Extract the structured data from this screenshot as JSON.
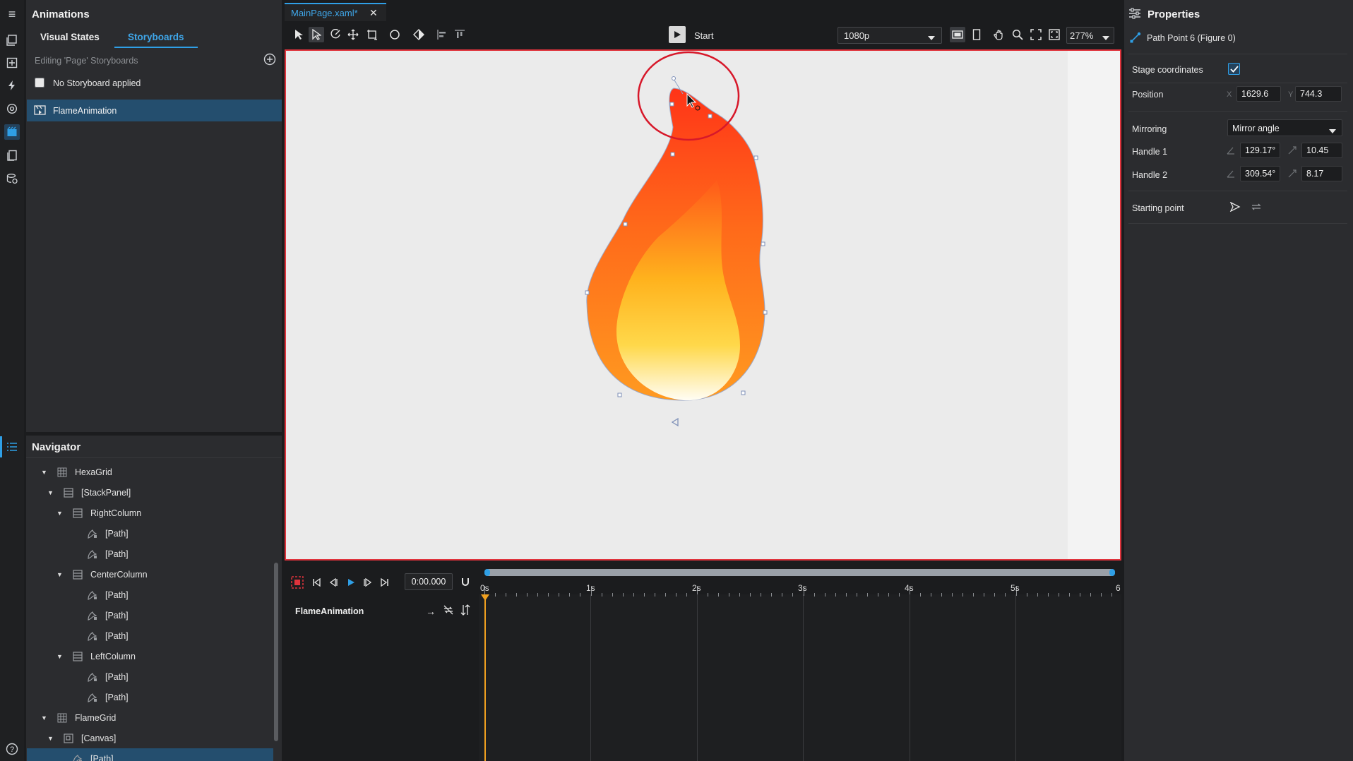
{
  "left_panel": {
    "title": "Animations",
    "tabs": [
      "Visual States",
      "Storyboards"
    ],
    "active_tab": "Storyboards",
    "editing_label": "Editing 'Page' Storyboards",
    "no_storyboard_label": "No Storyboard applied",
    "storyboards": [
      "FlameAnimation"
    ]
  },
  "navigator": {
    "title": "Navigator",
    "items": [
      {
        "label": "HexaGrid",
        "depth": 0,
        "kind": "grid",
        "expanded": true
      },
      {
        "label": "[StackPanel]",
        "depth": 1,
        "kind": "stack",
        "expanded": true
      },
      {
        "label": "RightColumn",
        "depth": 2,
        "kind": "stack",
        "expanded": true
      },
      {
        "label": "[Path]",
        "depth": 3,
        "kind": "path"
      },
      {
        "label": "[Path]",
        "depth": 3,
        "kind": "path"
      },
      {
        "label": "CenterColumn",
        "depth": 2,
        "kind": "stack",
        "expanded": true
      },
      {
        "label": "[Path]",
        "depth": 3,
        "kind": "path"
      },
      {
        "label": "[Path]",
        "depth": 3,
        "kind": "path"
      },
      {
        "label": "[Path]",
        "depth": 3,
        "kind": "path"
      },
      {
        "label": "LeftColumn",
        "depth": 2,
        "kind": "stack",
        "expanded": true
      },
      {
        "label": "[Path]",
        "depth": 3,
        "kind": "path"
      },
      {
        "label": "[Path]",
        "depth": 3,
        "kind": "path"
      },
      {
        "label": "FlameGrid",
        "depth": 0,
        "kind": "grid",
        "expanded": true
      },
      {
        "label": "[Canvas]",
        "depth": 1,
        "kind": "canvas",
        "expanded": true
      },
      {
        "label": "[Path]",
        "depth": 2,
        "kind": "path",
        "selected": true
      }
    ]
  },
  "document_tab": {
    "label": "MainPage.xaml*"
  },
  "toolbar": {
    "start_label": "Start",
    "resolution": "1080p",
    "zoom": "277%"
  },
  "timeline": {
    "time": "0:00.000",
    "animation_name": "FlameAnimation",
    "ticks": [
      "0s",
      "1s",
      "2s",
      "3s",
      "4s",
      "5s",
      "6"
    ]
  },
  "properties": {
    "title": "Properties",
    "subject": "Path Point 6 (Figure 0)",
    "stage_coordinates_label": "Stage coordinates",
    "stage_coordinates_checked": true,
    "position_label": "Position",
    "position_x_label": "X",
    "position_x": "1629.6",
    "position_y_label": "Y",
    "position_y": "744.3",
    "mirroring_label": "Mirroring",
    "mirroring_value": "Mirror angle",
    "handle1_label": "Handle 1",
    "handle1_angle": "129.17°",
    "handle1_length": "10.45",
    "handle2_label": "Handle 2",
    "handle2_angle": "309.54°",
    "handle2_length": "8.17",
    "starting_point_label": "Starting point"
  },
  "colors": {
    "accent": "#2f9fe6",
    "selection_bg": "#244e6e",
    "stage_border": "#e0333c",
    "flame_top": "#ff3d1a",
    "flame_mid": "#ff7a1c",
    "flame_core": "#ffd21f",
    "highlight_circle": "#d7182a",
    "playhead": "#f0a020"
  }
}
